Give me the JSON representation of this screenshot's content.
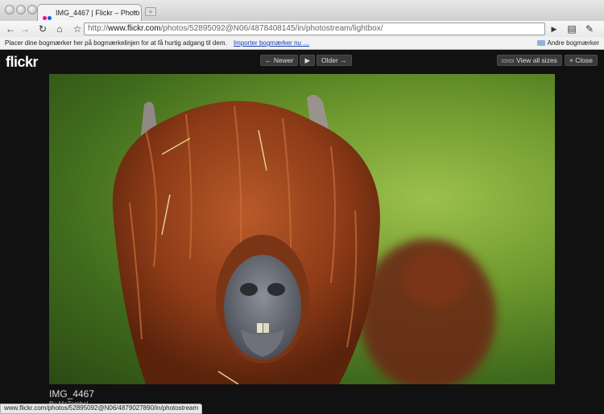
{
  "browser": {
    "tab_title": "IMG_4467 | Flickr – Photo Sh",
    "tab_close": "×",
    "new_tab": "+",
    "url_prefix": "http://",
    "url_host": "www.flickr.com",
    "url_path": "/photos/52895092@N06/4878408145/in/photostream/lightbox/",
    "bookmarks_hint": "Placer dine bogmærker her på bogmærkelinjen for at få hurtig adgang til dem.",
    "bookmarks_import": "Importer bogmærker nu …",
    "other_bookmarks": "Andre bogmærker",
    "status_url": "www.flickr.com/photos/52895092@N06/4879027890/in/photostream"
  },
  "lightbox": {
    "logo_main": "flick",
    "logo_r": "r",
    "newer": "← Newer",
    "play": "▶",
    "older": "Older →",
    "view_all_sizes": "View all sizes",
    "close": "× Close",
    "photo_title": "IMG_4467",
    "photo_by": "By MaTambel"
  },
  "icons": {
    "back": "back-arrow-icon",
    "forward": "forward-arrow-icon",
    "reload": "reload-icon",
    "home": "home-icon",
    "star": "star-icon",
    "go": "play-icon",
    "page": "page-menu-icon",
    "wrench": "wrench-icon"
  }
}
